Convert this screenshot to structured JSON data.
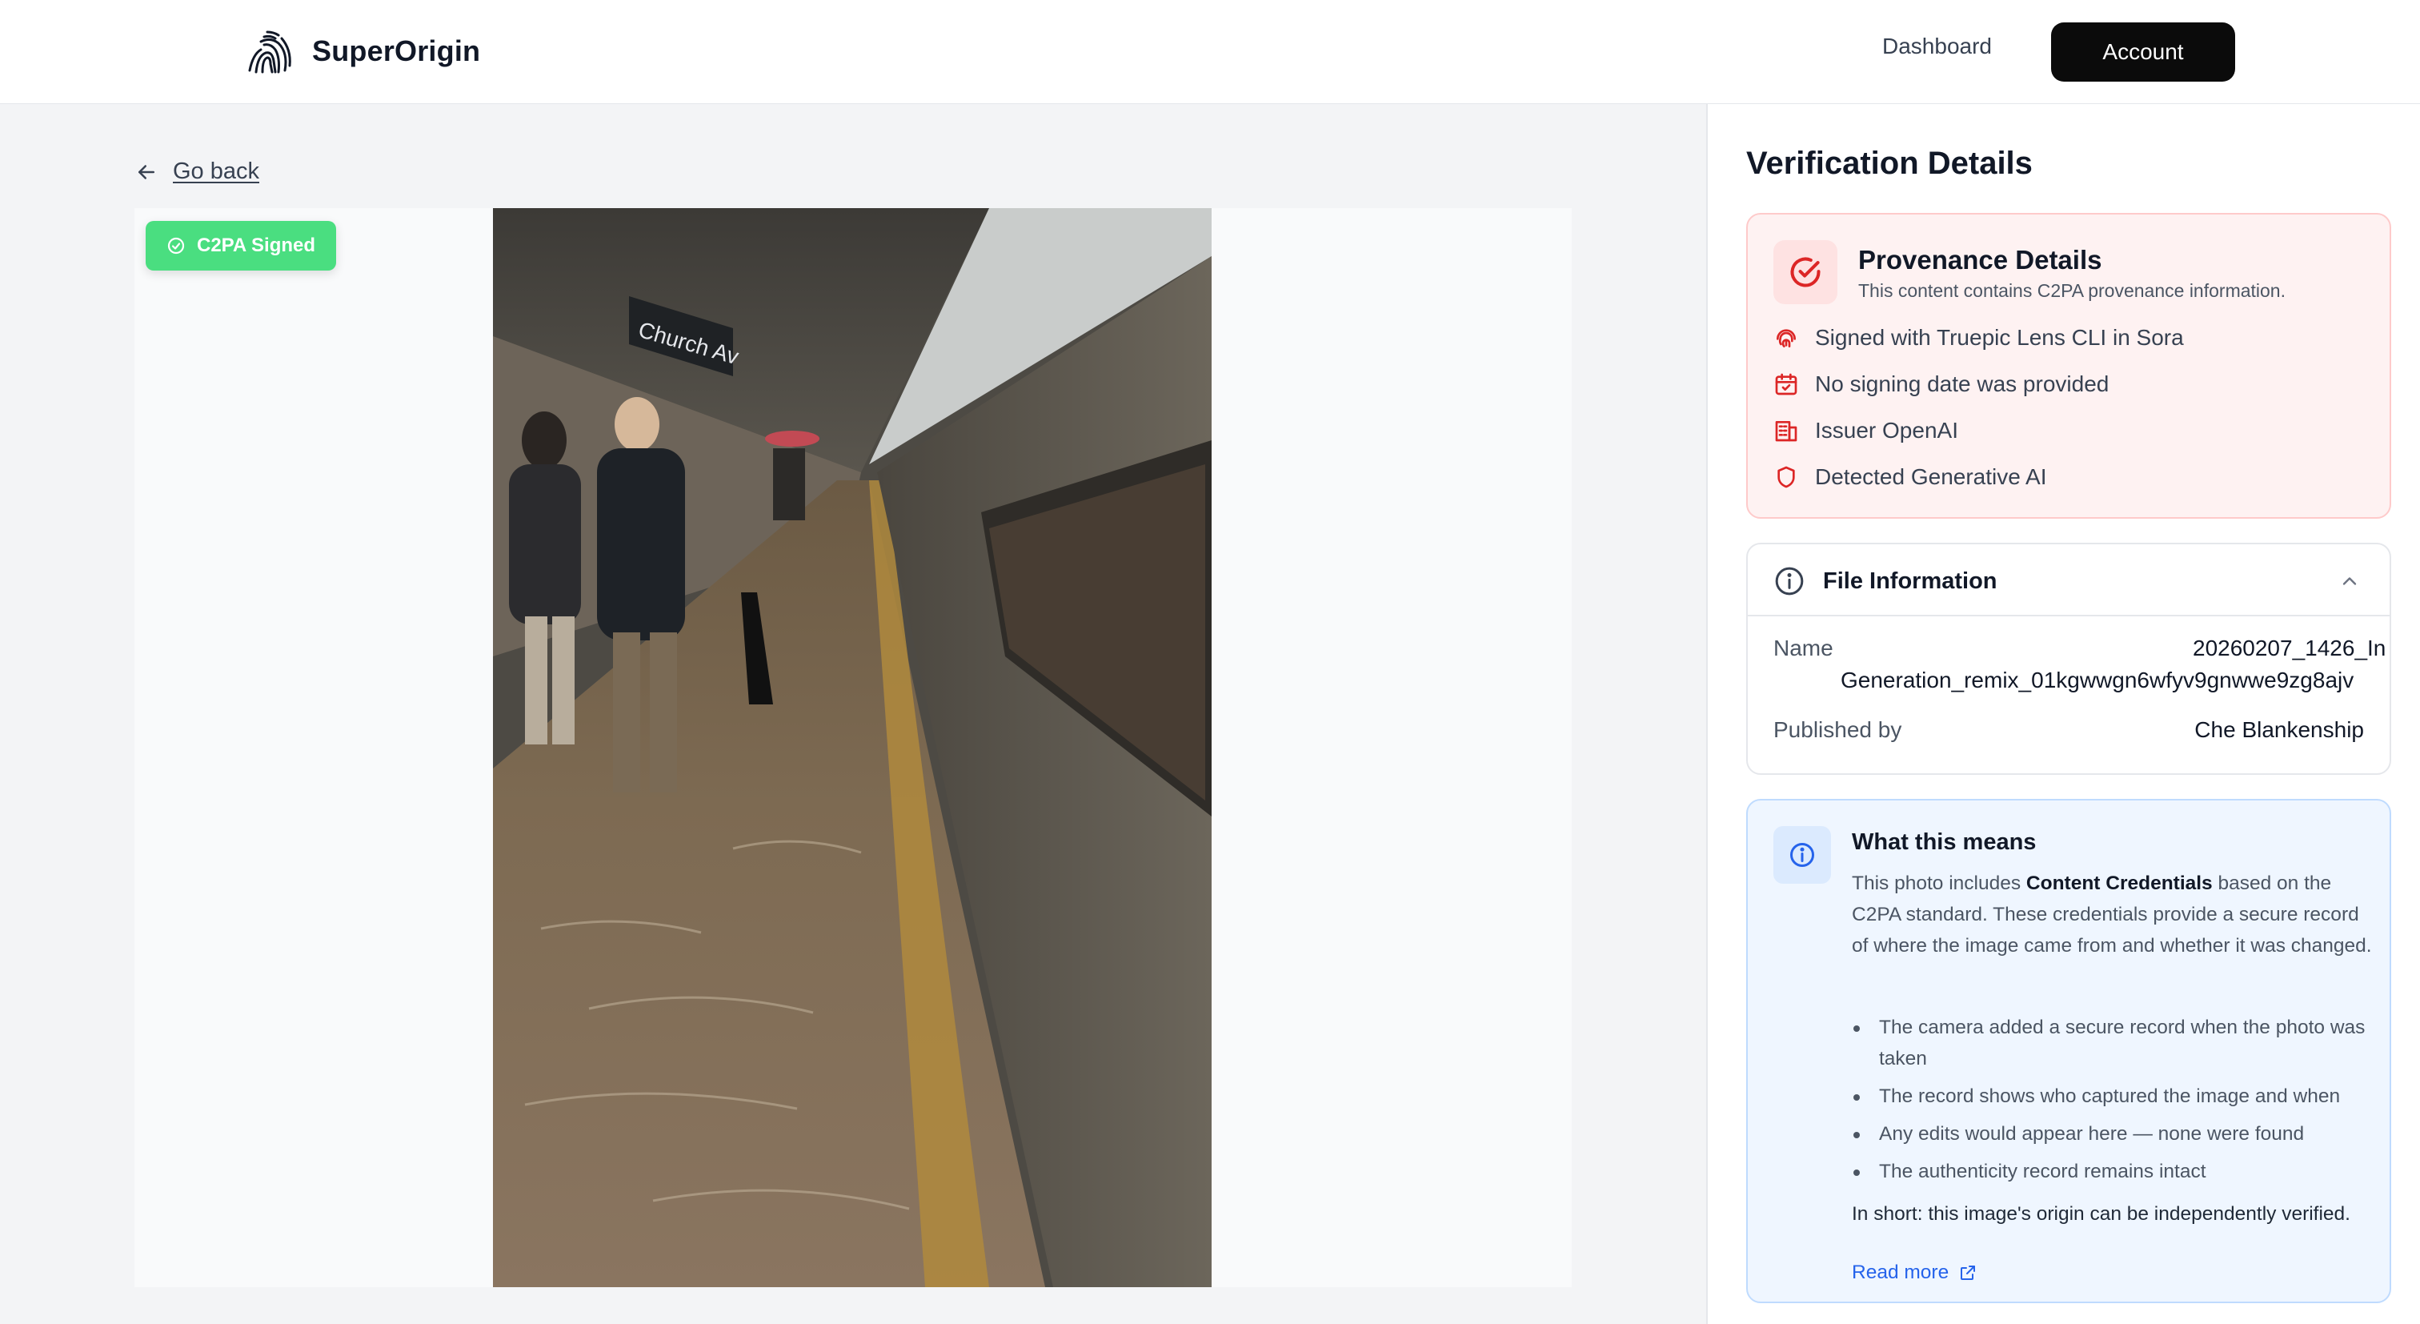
{
  "header": {
    "brand": "SuperOrigin",
    "nav_dashboard": "Dashboard",
    "nav_account": "Account"
  },
  "main": {
    "go_back": "Go back",
    "badge": "C2PA Signed",
    "image_alt": "Flooded subway platform at Church Avenue station with people walking beside a train"
  },
  "panel": {
    "title": "Verification Details",
    "provenance": {
      "title": "Provenance Details",
      "subtitle": "This content contains C2PA provenance information.",
      "rows": [
        {
          "icon": "fingerprint-icon",
          "text": "Signed with Truepic Lens CLI in Sora"
        },
        {
          "icon": "calendar-icon",
          "text": "No signing date was provided"
        },
        {
          "icon": "building-icon",
          "text": "Issuer OpenAI"
        },
        {
          "icon": "shield-icon",
          "text": "Detected Generative AI"
        }
      ]
    },
    "file_info": {
      "title": "File Information",
      "name_label": "Name",
      "name_line1": "20260207_1426_In",
      "name_line2": "Generation_remix_01kgwwgn6wfyv9gnwwe9zg8ajv",
      "published_label": "Published by",
      "published_value": "Che Blankenship"
    },
    "means": {
      "title": "What this means",
      "para_prefix": "This photo includes ",
      "para_bold": "Content Credentials",
      "para_suffix": " based on the C2PA standard. These credentials provide a secure record of where the image came from and whether it was changed.",
      "bullets": [
        "The camera added a secure record when the photo was taken",
        "The record shows who captured the image and when",
        "Any edits would appear here — none were found",
        "The authenticity record remains intact"
      ],
      "short": "In short: this image's origin can be independently verified.",
      "read_more": "Read more"
    }
  },
  "colors": {
    "badge_green": "#4ade80",
    "provenance_red": "#dc2626",
    "info_blue": "#2563eb"
  }
}
